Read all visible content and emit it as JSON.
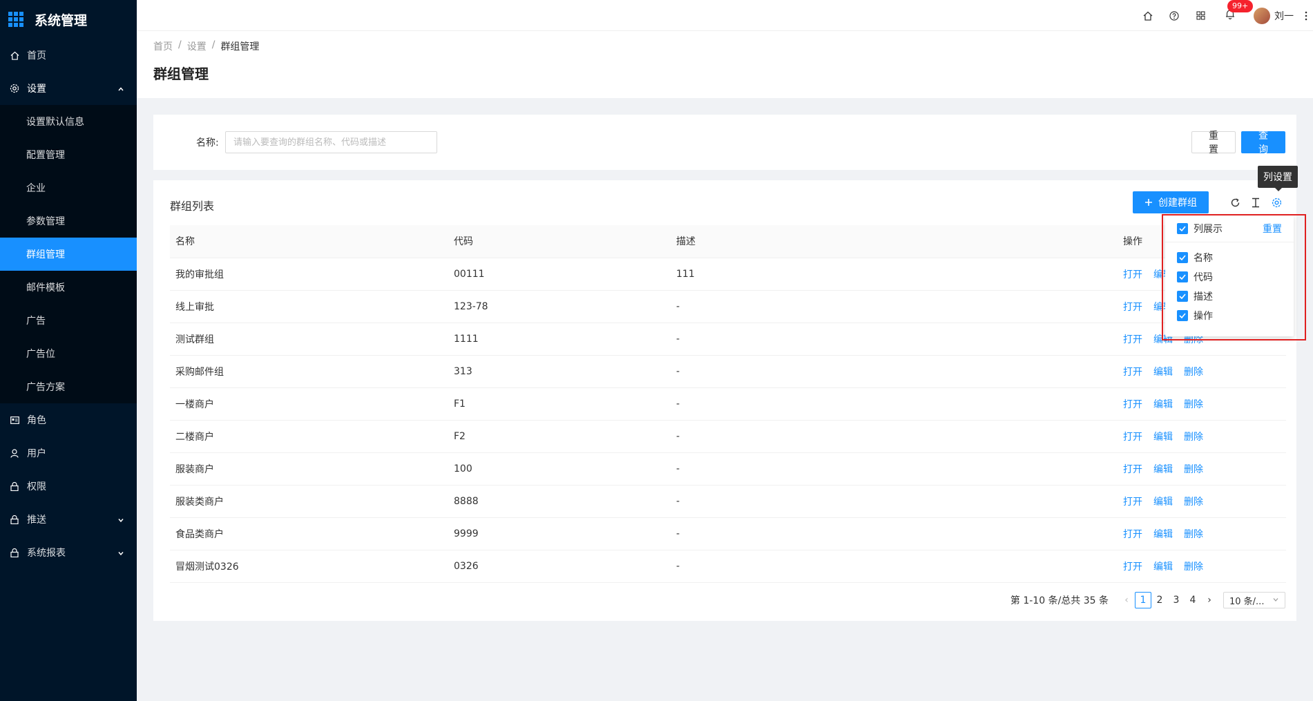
{
  "app": {
    "title": "系统管理"
  },
  "sidebar": {
    "items": [
      {
        "label": "首页",
        "icon": "home-icon"
      },
      {
        "label": "设置",
        "icon": "settings-icon"
      },
      {
        "label": "角色",
        "icon": "role-card-icon"
      },
      {
        "label": "用户",
        "icon": "user-icon"
      },
      {
        "label": "权限",
        "icon": "lock-icon"
      },
      {
        "label": "推送",
        "icon": "lock-icon"
      },
      {
        "label": "系统报表",
        "icon": "lock-icon"
      }
    ],
    "settings_sub": [
      {
        "label": "设置默认信息"
      },
      {
        "label": "配置管理"
      },
      {
        "label": "企业"
      },
      {
        "label": "参数管理"
      },
      {
        "label": "群组管理"
      },
      {
        "label": "邮件模板"
      },
      {
        "label": "广告"
      },
      {
        "label": "广告位"
      },
      {
        "label": "广告方案"
      }
    ]
  },
  "header": {
    "notification_badge": "99+",
    "user_name": "刘一"
  },
  "breadcrumb": [
    "首页",
    "设置",
    "群组管理"
  ],
  "page_title": "群组管理",
  "search": {
    "label": "名称:",
    "placeholder": "请输入要查询的群组名称、代码或描述",
    "reset_label": "重 置",
    "query_label": "查 询"
  },
  "list": {
    "title": "群组列表",
    "create_label": "创建群组",
    "columns": [
      "名称",
      "代码",
      "描述",
      "操作"
    ],
    "actions": [
      "打开",
      "编辑",
      "删除"
    ],
    "rows": [
      {
        "name": "我的审批组",
        "code": "00111",
        "desc": "111"
      },
      {
        "name": "线上审批",
        "code": "123-78",
        "desc": "-"
      },
      {
        "name": "测试群组",
        "code": "1111",
        "desc": "-"
      },
      {
        "name": "采购邮件组",
        "code": "313",
        "desc": "-"
      },
      {
        "name": "一楼商户",
        "code": "F1",
        "desc": "-"
      },
      {
        "name": "二楼商户",
        "code": "F2",
        "desc": "-"
      },
      {
        "name": "服装商户",
        "code": "100",
        "desc": "-"
      },
      {
        "name": "服装类商户",
        "code": "8888",
        "desc": "-"
      },
      {
        "name": "食品类商户",
        "code": "9999",
        "desc": "-"
      },
      {
        "name": "冒烟测试0326",
        "code": "0326",
        "desc": "-"
      }
    ]
  },
  "pagination": {
    "total_text": "第 1-10 条/总共 35 条",
    "pages": [
      "1",
      "2",
      "3",
      "4"
    ],
    "current": "1",
    "page_size": "10 条/..."
  },
  "column_settings": {
    "tooltip": "列设置",
    "header_label": "列展示",
    "reset_label": "重置",
    "options": [
      "名称",
      "代码",
      "描述",
      "操作"
    ]
  },
  "colors": {
    "primary": "#1890ff",
    "sidebar": "#001529",
    "highlight": "#e02020"
  }
}
